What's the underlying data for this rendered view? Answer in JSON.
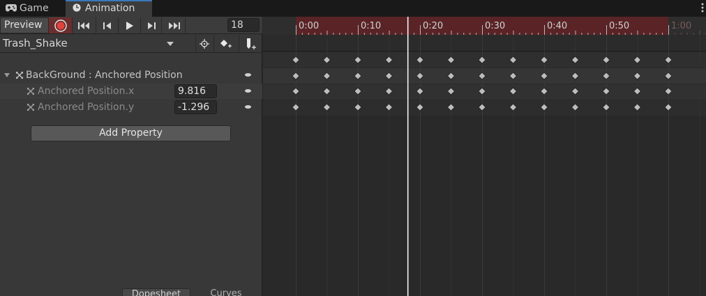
{
  "tabs": {
    "game": {
      "label": "Game",
      "icon": "gamepad-icon"
    },
    "animation": {
      "label": "Animation",
      "icon": "clock-icon"
    }
  },
  "toolbar": {
    "preview_label": "Preview",
    "frame_value": "18",
    "record_color": "#e0433b"
  },
  "clip": {
    "name": "Trash_Shake"
  },
  "properties": {
    "group_label": "BackGround : Anchored Position",
    "x_label": "Anchored Position.x",
    "x_value": "9.816",
    "y_label": "Anchored Position.y",
    "y_value": "-1.296"
  },
  "add_property_label": "Add Property",
  "bottom_tabs": {
    "dopesheet": "Dopesheet",
    "curves": "Curves"
  },
  "timeline": {
    "ticks": [
      "0:00",
      "0:10",
      "0:20",
      "0:30",
      "0:40",
      "0:50",
      "1:00"
    ],
    "current_frame": 18,
    "keyframe_frames": [
      0,
      5,
      10,
      15,
      20,
      25,
      30,
      35,
      40,
      45,
      50,
      55,
      60
    ],
    "recording_color": "#5a2426"
  }
}
